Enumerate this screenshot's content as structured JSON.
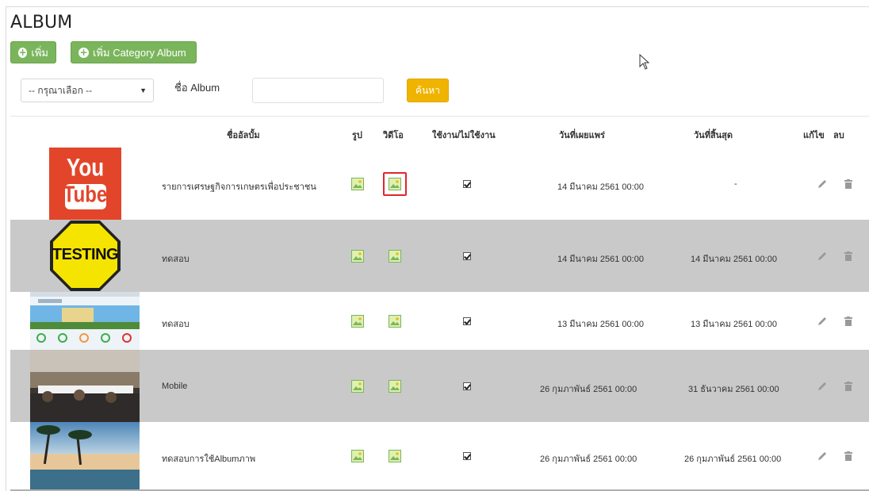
{
  "header": {
    "title": "ALBUM",
    "add_label": "เพิ่ม",
    "add_category_label": "เพิ่ม Category Album"
  },
  "filter": {
    "select_value": "-- กรุณาเลือก --",
    "album_name_label": "ชื่อ Album",
    "album_name_value": "",
    "search_label": "ค้นหา"
  },
  "table": {
    "headers": {
      "name": "ชื่ออัลบั้ม",
      "photo": "รูป",
      "video": "วิดีโอ",
      "status": "ใช้งาน/ไม่ใช้งาน",
      "publish": "วันที่เผยแพร่",
      "end": "วันที่สิ้นสุด",
      "edit": "แก้ไข",
      "delete": "ลบ"
    },
    "rows": [
      {
        "thumb": "youtube-logo-thumbnail",
        "name": "รายการเศรษฐกิจการเกษตรเพื่อประชาชน",
        "active": true,
        "publish": "14 มีนาคม 2561 00:00",
        "end": "-"
      },
      {
        "thumb": "testing-sign-thumbnail",
        "name": "ทดสอบ",
        "active": true,
        "publish": "14 มีนาคม 2561 00:00",
        "end": "14 มีนาคม 2561 00:00"
      },
      {
        "thumb": "website-screenshot-thumbnail",
        "name": "ทดสอบ",
        "active": true,
        "publish": "13 มีนาคม 2561 00:00",
        "end": "13 มีนาคม 2561 00:00"
      },
      {
        "thumb": "meeting-room-thumbnail",
        "name": "Mobile",
        "active": true,
        "publish": "26 กุมภาพันธ์ 2561 00:00",
        "end": "31 ธันวาคม 2561 00:00"
      },
      {
        "thumb": "beach-palm-thumbnail",
        "name": "ทดสอบการใช้Albumภาพ",
        "active": true,
        "publish": "26 กุมภาพันธ์ 2561 00:00",
        "end": "26 กุมภาพันธ์ 2561 00:00"
      }
    ]
  },
  "thumb_text": {
    "youtube_you": "You",
    "youtube_tube": "Tube",
    "testing": "TESTING"
  },
  "colors": {
    "green_button": "#7ab55c",
    "search_button": "#f0b400",
    "alt_row": "#c9c9c9",
    "highlight": "#e0262b",
    "youtube_red": "#e2452a"
  }
}
